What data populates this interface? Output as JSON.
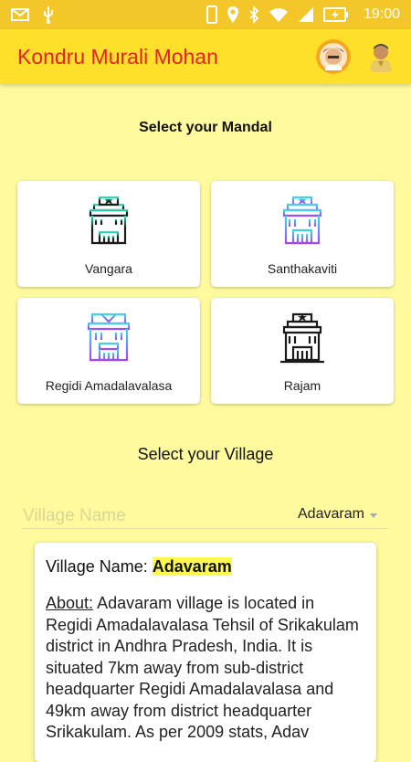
{
  "status_bar": {
    "time": "19:00"
  },
  "app_bar": {
    "title": "Kondru Murali Mohan"
  },
  "mandal_section": {
    "heading": "Select your Mandal",
    "mandals": [
      {
        "label": "Vangara",
        "icon": "building-icon"
      },
      {
        "label": "Santhakaviti",
        "icon": "building-icon"
      },
      {
        "label": "Regidi Amadalavalasa",
        "icon": "building-icon"
      },
      {
        "label": "Rajam",
        "icon": "building-icon"
      }
    ]
  },
  "village_section": {
    "heading": "Select your Village",
    "input_placeholder": "Village Name",
    "selected_village": "Adavaram"
  },
  "village_info": {
    "name_label": "Village Name:",
    "name_value": "Adavaram",
    "about_label": "About:",
    "about_text": "Adavaram village is located in Regidi Amadalavalasa Tehsil of Srikakulam district in Andhra Pradesh, India. It is situated 7km away from sub-district headquarter Regidi Amadalavalasa and 49km away from district headquarter Srikakulam. As per 2009 stats, Adav"
  },
  "colors": {
    "status_bar": "#F3C72A",
    "app_bar": "#FEE02A",
    "background": "#FFFA9E",
    "title": "#E32222",
    "highlight": "#FFF94D"
  }
}
